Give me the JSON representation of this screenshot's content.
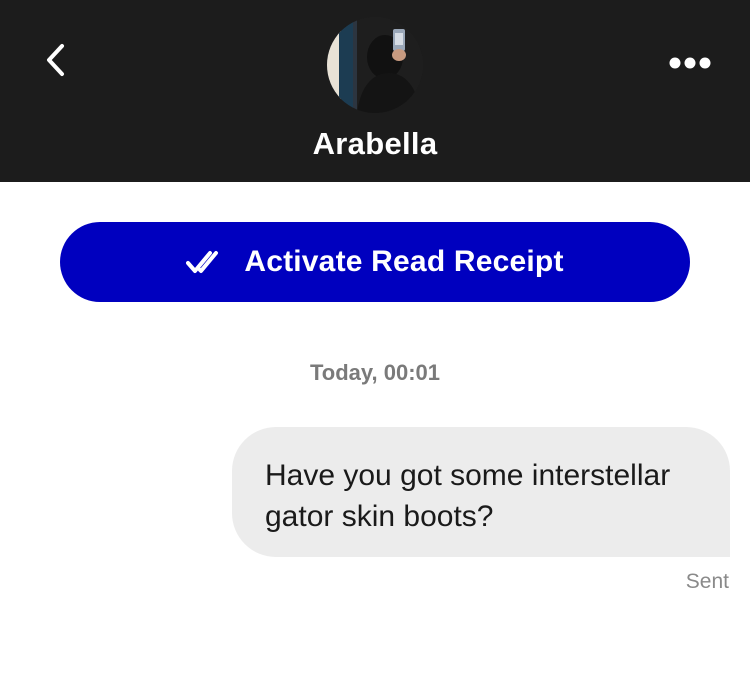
{
  "header": {
    "contact_name": "Arabella",
    "back_icon": "chevron-left-icon",
    "more_icon": "more-horizontal-icon",
    "avatar_alt": "profile photo"
  },
  "actions": {
    "read_receipt_label": "Activate Read Receipt",
    "read_receipt_icon": "double-check-icon",
    "accent_color": "#0000bf"
  },
  "conversation": {
    "timestamp": "Today, 00:01",
    "messages": [
      {
        "direction": "outgoing",
        "text": "Have you got some interstellar gator skin boots?",
        "status": "Sent"
      }
    ]
  },
  "colors": {
    "header_bg": "#1c1c1c",
    "bubble_bg": "#ececec"
  }
}
